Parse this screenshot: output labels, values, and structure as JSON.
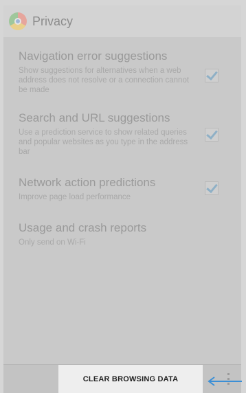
{
  "header": {
    "title": "Privacy",
    "icon": "chrome-icon"
  },
  "settings": [
    {
      "label": "Navigation error suggestions",
      "description": "Show suggestions for alternatives when a web address does not resolve or a connection cannot be made",
      "checked": true
    },
    {
      "label": "Search and URL suggestions",
      "description": "Use a prediction service to show related queries and popular websites as you type in the address bar",
      "checked": true
    },
    {
      "label": "Network action predictions",
      "description": "Improve page load performance",
      "checked": true
    },
    {
      "label": "Usage and crash reports",
      "description": "Only send on Wi-Fi"
    }
  ],
  "footer": {
    "clear_label": "CLEAR BROWSING DATA"
  },
  "colors": {
    "annotation_arrow": "#3b8fd6"
  }
}
